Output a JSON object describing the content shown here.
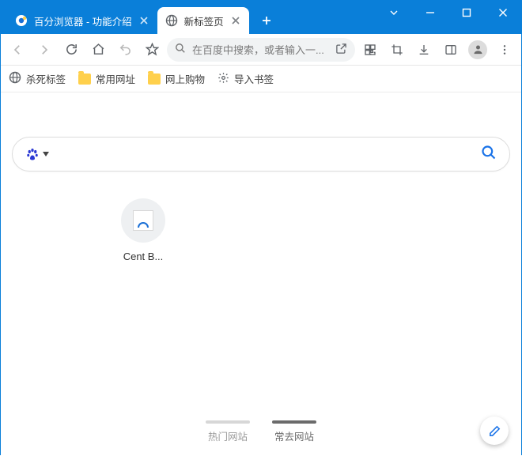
{
  "window": {
    "tabs": [
      {
        "title": "百分浏览器 - 功能介绍",
        "active": false
      },
      {
        "title": "新标签页",
        "active": true
      }
    ]
  },
  "toolbar": {
    "omnibox_placeholder": "在百度中搜索，或者输入一..."
  },
  "bookmarks": [
    {
      "kind": "page",
      "label": "杀死标签"
    },
    {
      "kind": "folder",
      "label": "常用网址"
    },
    {
      "kind": "folder",
      "label": "网上购物"
    },
    {
      "kind": "import",
      "label": "导入书签"
    }
  ],
  "newtab": {
    "shortcuts": [
      {
        "label": "Cent B..."
      }
    ],
    "bottom_tabs": [
      {
        "label": "热门网站",
        "active": false
      },
      {
        "label": "常去网站",
        "active": true
      }
    ]
  }
}
